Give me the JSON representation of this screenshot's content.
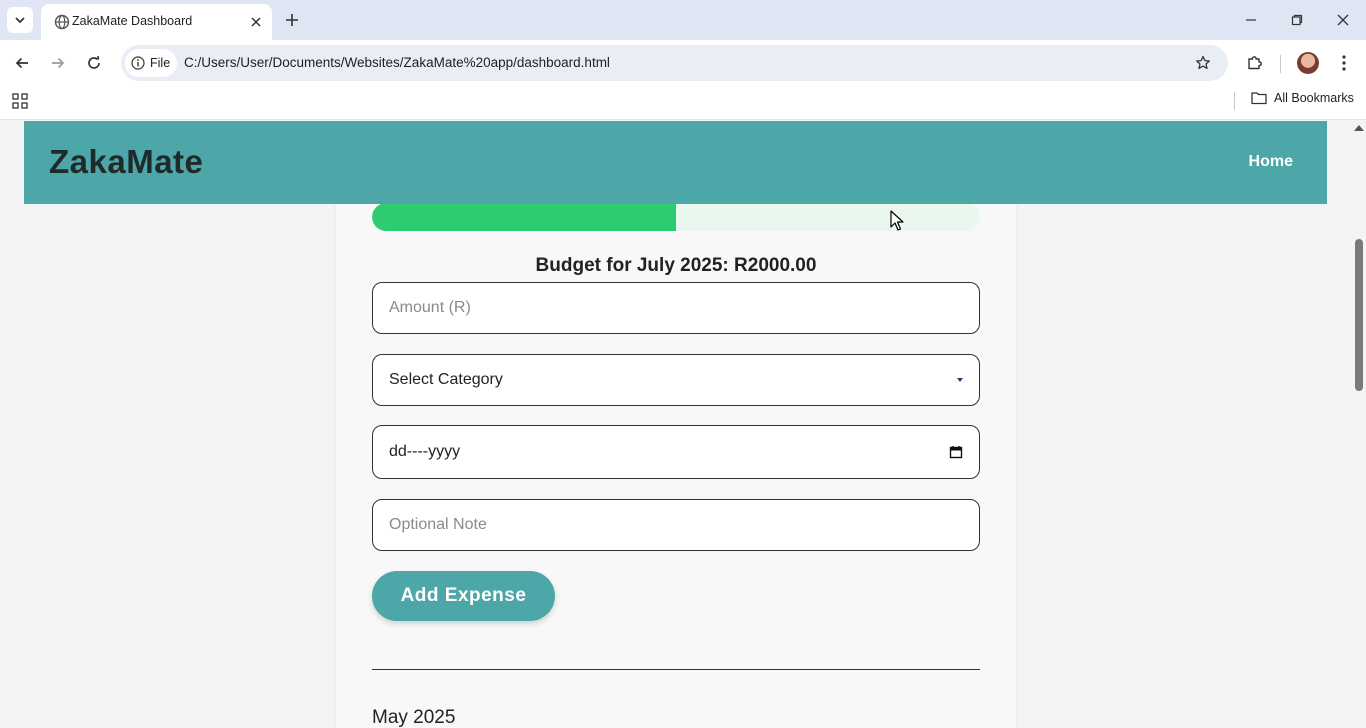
{
  "browser": {
    "tab_title": "ZakaMate Dashboard",
    "site_chip_label": "File",
    "url": "C:/Users/User/Documents/Websites/ZakaMate%20app/dashboard.html",
    "bookmarks_folder": "All Bookmarks"
  },
  "header": {
    "logo": "ZakaMate",
    "nav_home": "Home"
  },
  "progress": {
    "fraction": 0.5,
    "color": "#2ecc71"
  },
  "budget": {
    "text": "Budget for July 2025: R2000.00"
  },
  "form": {
    "amount_placeholder": "Amount (R)",
    "category_selected": "Select Category",
    "date_placeholder": "dd----yyyy",
    "note_placeholder": "Optional Note",
    "submit_label": "Add Expense"
  },
  "history": {
    "month_heading": "May 2025"
  },
  "colors": {
    "accent": "#4da6a8",
    "progress": "#2ecc71"
  }
}
